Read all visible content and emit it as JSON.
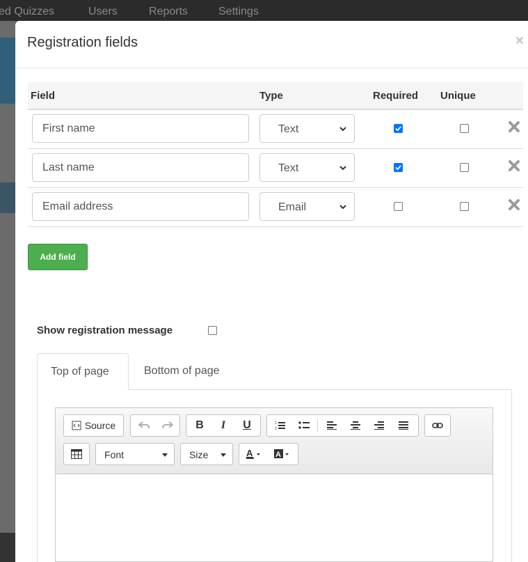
{
  "app_nav": [
    "ed Quizzes",
    "Users",
    "Reports",
    "Settings"
  ],
  "modal": {
    "title": "Registration fields",
    "close": "×"
  },
  "table": {
    "headers": {
      "field": "Field",
      "type": "Type",
      "required": "Required",
      "unique": "Unique"
    },
    "rows": [
      {
        "field_value": "First name",
        "type": "Text",
        "required": true,
        "unique": false
      },
      {
        "field_value": "Last name",
        "type": "Text",
        "required": true,
        "unique": false
      },
      {
        "field_value": "Email address",
        "type": "Email",
        "required": false,
        "unique": false
      }
    ]
  },
  "add_field_label": "Add field",
  "registration_message": {
    "label": "Show registration message",
    "checked": false
  },
  "tabs": [
    {
      "label": "Top of page",
      "active": true
    },
    {
      "label": "Bottom of page",
      "active": false
    }
  ],
  "editor": {
    "source_label": "Source",
    "font_label": "Font",
    "size_label": "Size",
    "content": ""
  },
  "colors": {
    "accent_checkbox": "#0075ff",
    "add_button": "#4cae4c"
  }
}
